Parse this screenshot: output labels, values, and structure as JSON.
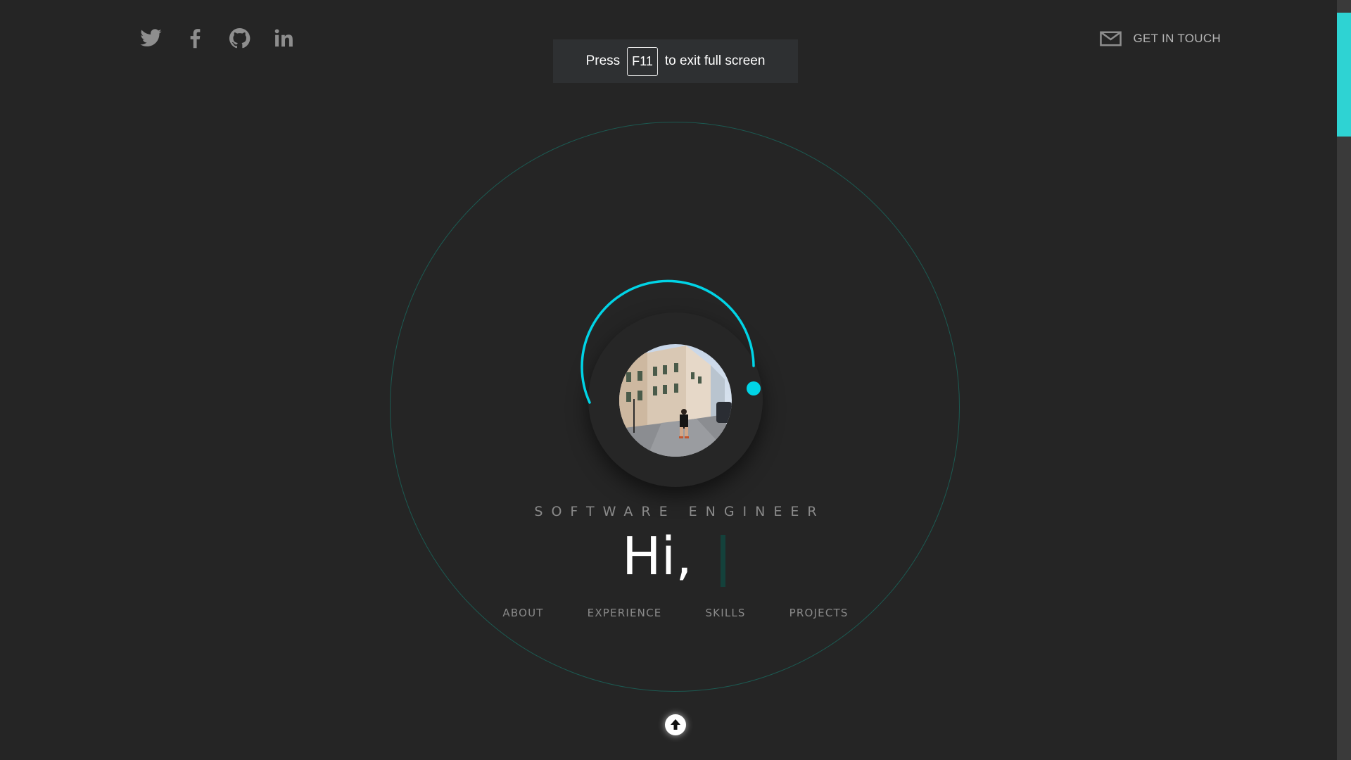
{
  "socials": [
    {
      "name": "Twitter",
      "icon": "twitter-icon"
    },
    {
      "name": "Facebook",
      "icon": "facebook-icon"
    },
    {
      "name": "GitHub",
      "icon": "github-icon"
    },
    {
      "name": "LinkedIn",
      "icon": "linkedin-icon"
    }
  ],
  "contact": {
    "label": "GET IN TOUCH",
    "icon": "mail-icon"
  },
  "fullscreen_notice": {
    "before": "Press",
    "key": "F11",
    "after": "to exit full screen"
  },
  "hero": {
    "role": "SOFTWARE ENGINEER",
    "greeting": "Hi,"
  },
  "nav": {
    "items": [
      {
        "label": "ABOUT"
      },
      {
        "label": "EXPERIENCE"
      },
      {
        "label": "SKILLS"
      },
      {
        "label": "PROJECTS"
      }
    ]
  },
  "scroll_up": {
    "icon": "arrow-up-icon"
  },
  "colors": {
    "background": "#252525",
    "accent": "#00d4e6",
    "orbit": "#1c5a52",
    "text_muted": "#8a8a8a"
  }
}
